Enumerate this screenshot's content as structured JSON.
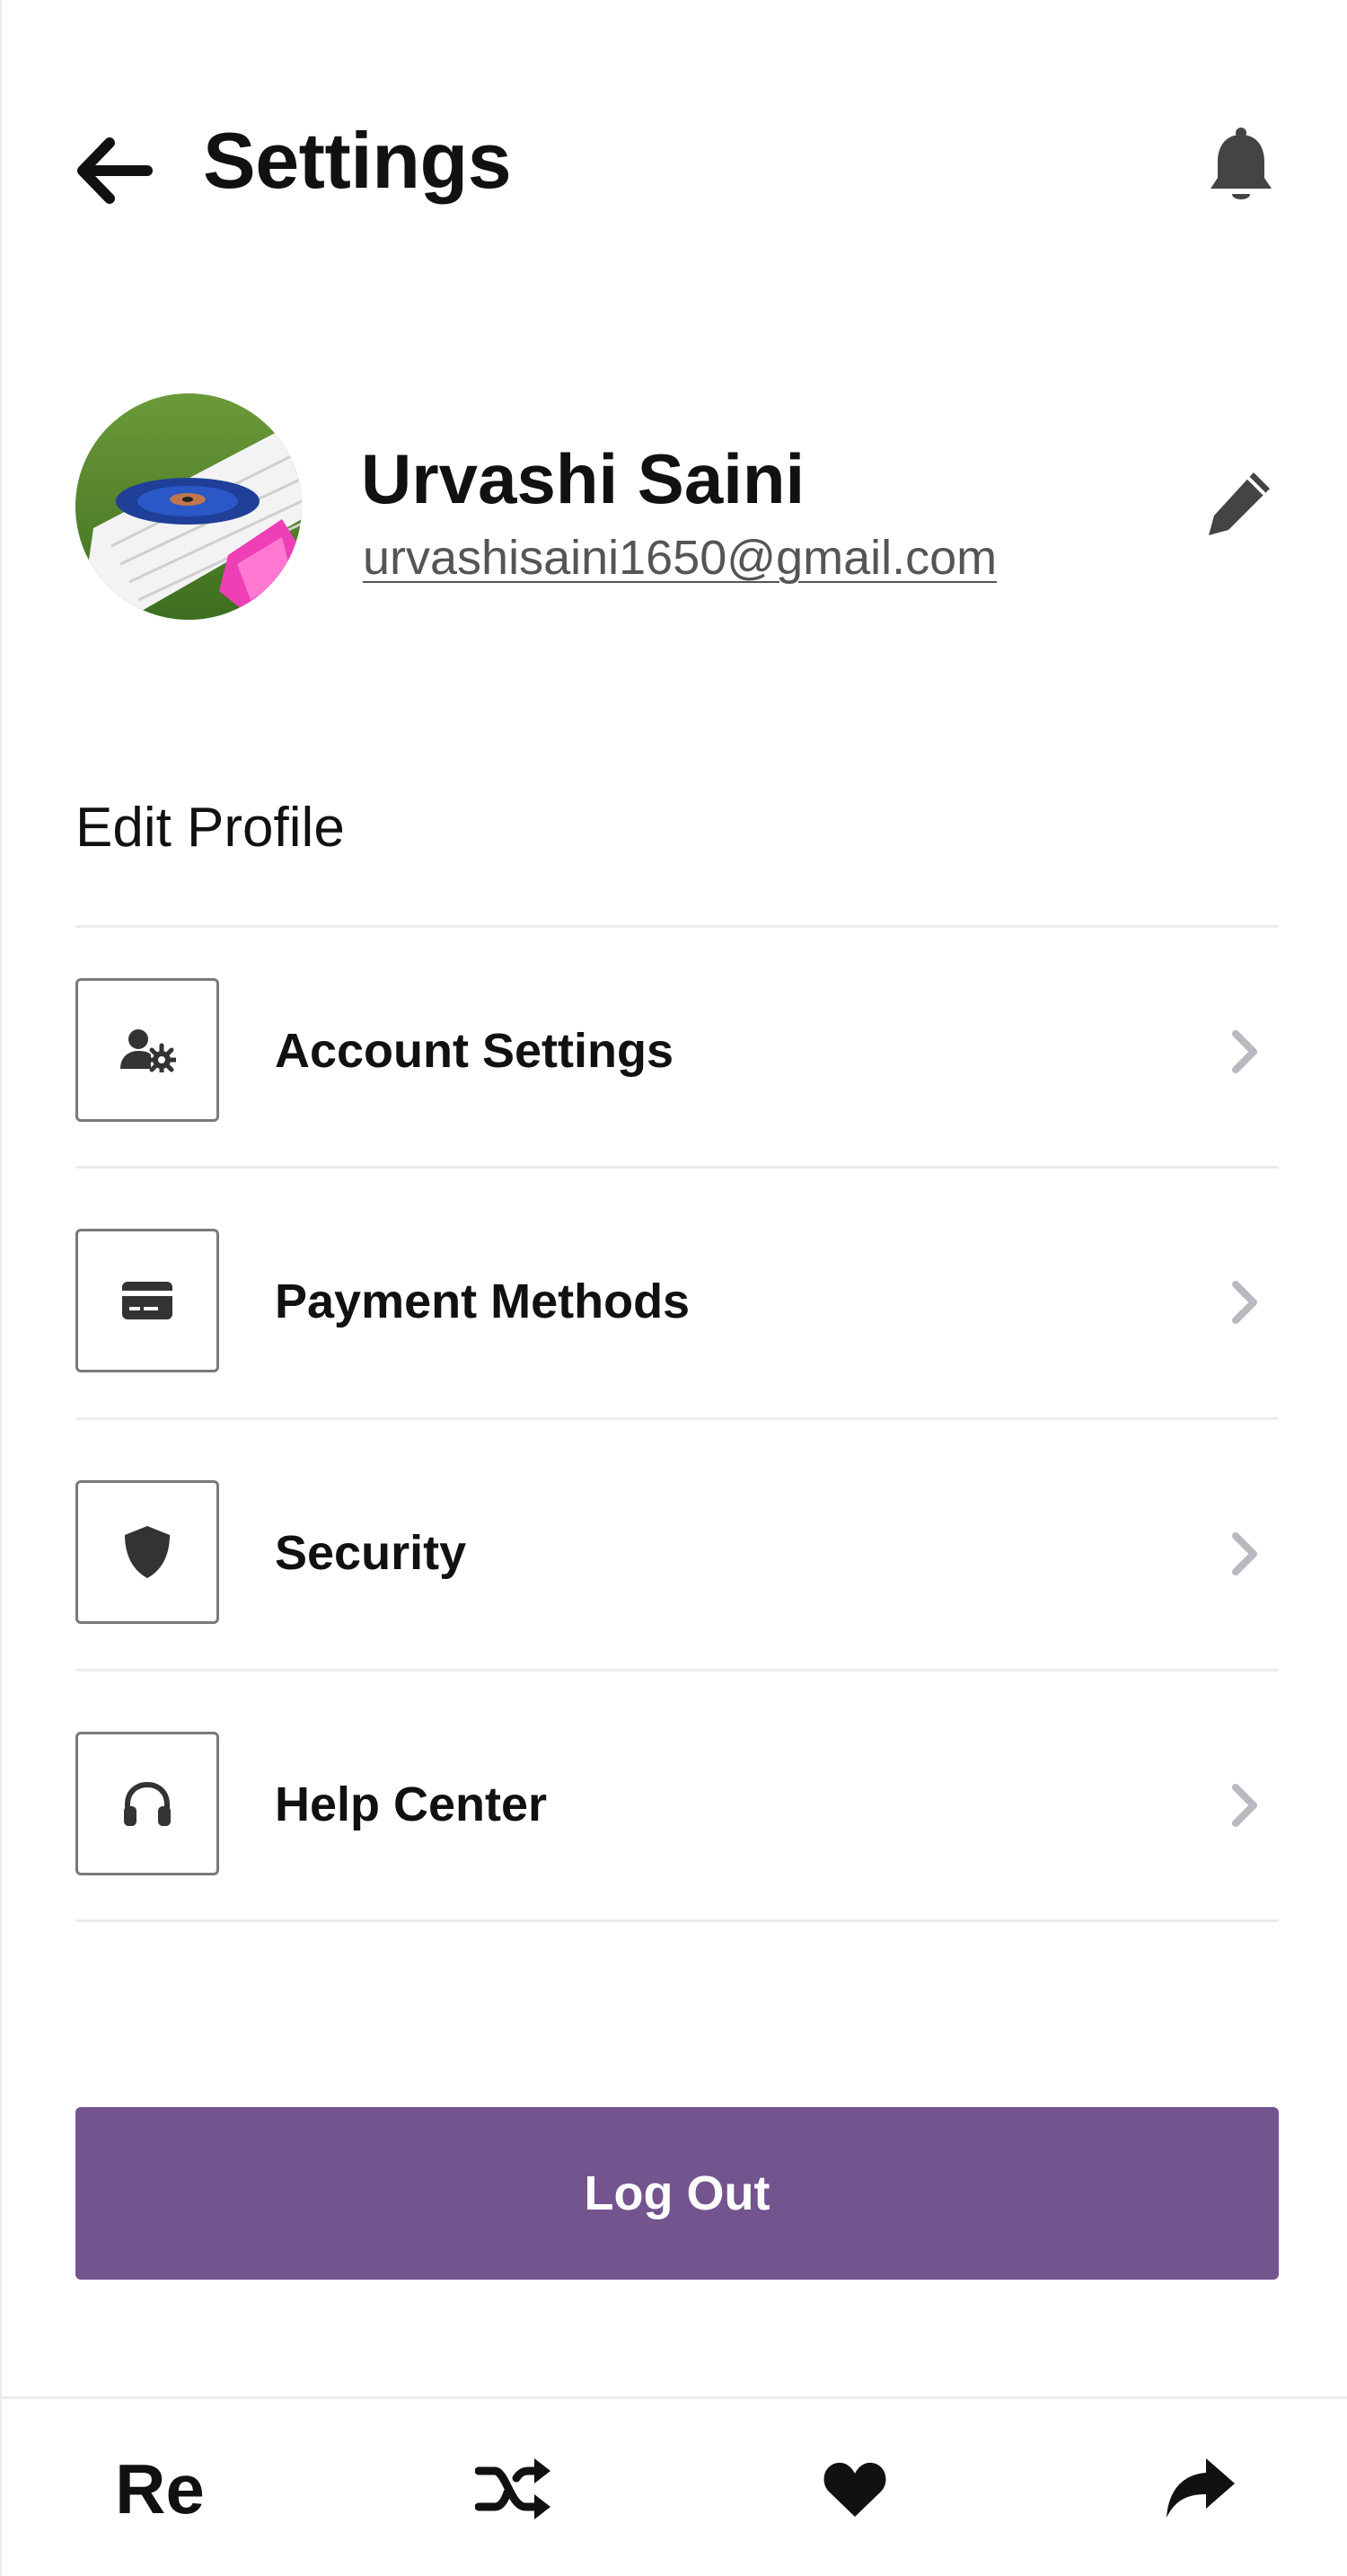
{
  "header": {
    "title": "Settings",
    "back_icon": "arrow-left-icon",
    "bell_icon": "bell-icon"
  },
  "profile": {
    "name": "Urvashi Saini",
    "email": "urvashisaini1650@gmail.com",
    "edit_icon": "pencil-icon"
  },
  "section": {
    "title": "Edit Profile"
  },
  "menu": {
    "items": [
      {
        "label": "Account Settings",
        "icon": "user-gear-icon"
      },
      {
        "label": "Payment Methods",
        "icon": "credit-card-icon"
      },
      {
        "label": "Security",
        "icon": "shield-icon"
      },
      {
        "label": "Help Center",
        "icon": "headphones-icon"
      }
    ]
  },
  "logout": {
    "label": "Log Out"
  },
  "bottom_nav": {
    "items": [
      {
        "label": "Re",
        "icon": "text-re"
      },
      {
        "label": "",
        "icon": "shuffle-icon"
      },
      {
        "label": "",
        "icon": "heart-icon"
      },
      {
        "label": "",
        "icon": "share-arrow-icon"
      }
    ]
  },
  "colors": {
    "accent": "#74548f",
    "text": "#111111",
    "muted": "#555555",
    "divider": "#ececec",
    "chevron": "#b9b9c0"
  }
}
